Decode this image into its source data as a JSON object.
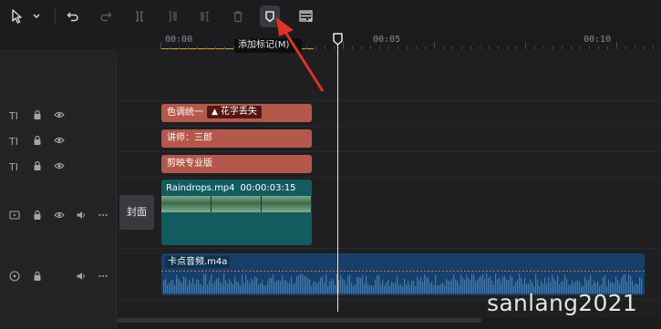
{
  "toolbar": {
    "select_tool_icon": "cursor-arrow-icon",
    "undo_icon": "undo-icon",
    "redo_icon": "redo-icon",
    "split_icon": "split-icon",
    "trim_left_icon": "trim-left-icon",
    "trim_right_icon": "trim-right-icon",
    "delete_icon": "trash-icon",
    "marker_icon": "marker-icon",
    "subtitle_icon": "subtitle-list-icon"
  },
  "tooltip": {
    "text": "添加标记(M)"
  },
  "ruler": {
    "labels": [
      "00:00",
      "00:05",
      "00:10"
    ]
  },
  "tracks": {
    "text_icon": "TI",
    "text_clips": [
      {
        "label": "色调统一",
        "warning": "花字丢失"
      },
      {
        "label": "讲师：三郎"
      },
      {
        "label": "剪映专业版"
      }
    ],
    "cover_label": "封面",
    "video_clip": {
      "name": "Raindrops.mp4",
      "duration": "00:00:03:15"
    },
    "audio_clip": {
      "name": "卡点音频.m4a"
    }
  },
  "watermark": "sanlang2021",
  "colors": {
    "accent_arrow": "#e0302a",
    "text_clip": "#b3584a",
    "video_clip": "#125b5f",
    "audio_clip": "#163f6a",
    "playhead": "#e9e9e9"
  }
}
